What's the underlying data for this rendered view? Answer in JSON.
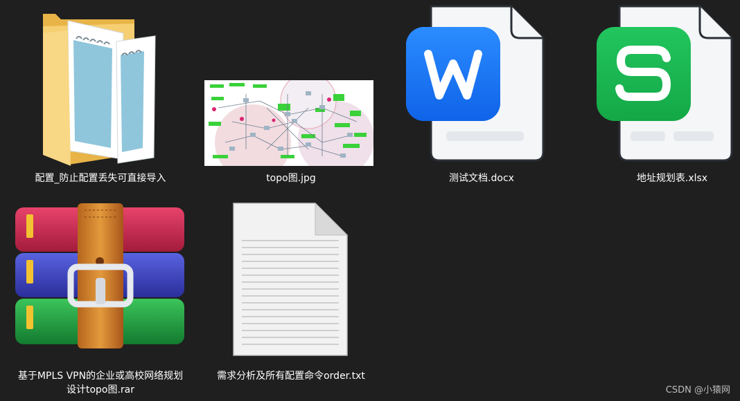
{
  "files": [
    {
      "name": "配置_防止配置丢失可直接导入",
      "icon": "folder-icon"
    },
    {
      "name": "topo图.jpg",
      "icon": "image-thumbnail-icon"
    },
    {
      "name": "测试文档.docx",
      "icon": "wps-writer-icon"
    },
    {
      "name": "地址规划表.xlsx",
      "icon": "wps-spreadsheet-icon"
    },
    {
      "name_line1": "基于MPLS VPN的企业或高校网络规划",
      "name_line2": "设计topo图.rar",
      "icon": "winrar-archive-icon"
    },
    {
      "name": "需求分析及所有配置命令order.txt",
      "icon": "text-document-icon"
    }
  ],
  "watermark": "CSDN @小猿网",
  "colors": {
    "background": "#1f1f1f",
    "wps_writer": "#1677ff",
    "wps_spreadsheet": "#1db954",
    "folder": "#f4c95d"
  }
}
